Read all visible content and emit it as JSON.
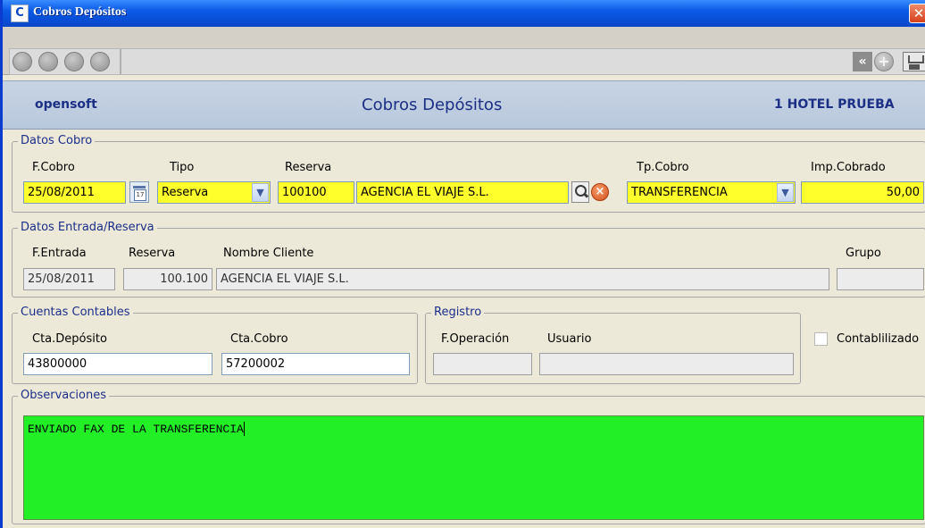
{
  "window": {
    "title": "Cobros Depósitos",
    "app_icon": "C",
    "close_label": "✕"
  },
  "toolbar": {
    "prev_label": "«",
    "add_label": "+"
  },
  "header": {
    "brand": "opensoft",
    "title": "Cobros Depósitos",
    "hotel": "1 HOTEL PRUEBA"
  },
  "datos_cobro": {
    "legend": "Datos Cobro",
    "f_cobro_label": "F.Cobro",
    "f_cobro": "25/08/2011",
    "tipo_label": "Tipo",
    "tipo": "Reserva",
    "reserva_label": "Reserva",
    "reserva": "100100",
    "cliente": "AGENCIA EL VIAJE S.L.",
    "tp_cobro_label": "Tp.Cobro",
    "tp_cobro": "TRANSFERENCIA",
    "imp_label": "Imp.Cobrado",
    "importe": "50,00"
  },
  "datos_entrada": {
    "legend": "Datos Entrada/Reserva",
    "f_entrada_label": "F.Entrada",
    "f_entrada": "25/08/2011",
    "reserva_label": "Reserva",
    "reserva": "100.100",
    "nombre_label": "Nombre Cliente",
    "nombre": "AGENCIA EL VIAJE S.L.",
    "grupo_label": "Grupo",
    "grupo": ""
  },
  "cuentas": {
    "legend": "Cuentas Contables",
    "deposito_label": "Cta.Depósito",
    "deposito": "43800000",
    "cobro_label": "Cta.Cobro",
    "cobro": "57200002"
  },
  "registro": {
    "legend": "Registro",
    "f_operacion_label": "F.Operación",
    "f_operacion": "",
    "usuario_label": "Usuario",
    "usuario": ""
  },
  "contabilizado_label": "Contablilizado",
  "observaciones": {
    "legend": "Observaciones",
    "text": "ENVIADO FAX DE LA TRANSFERENCIA"
  },
  "colors": {
    "required_field": "#ffff2b",
    "notes_bg": "#23ef26",
    "title_bar": "#0b5ae6",
    "header_text": "#1b2f84"
  }
}
